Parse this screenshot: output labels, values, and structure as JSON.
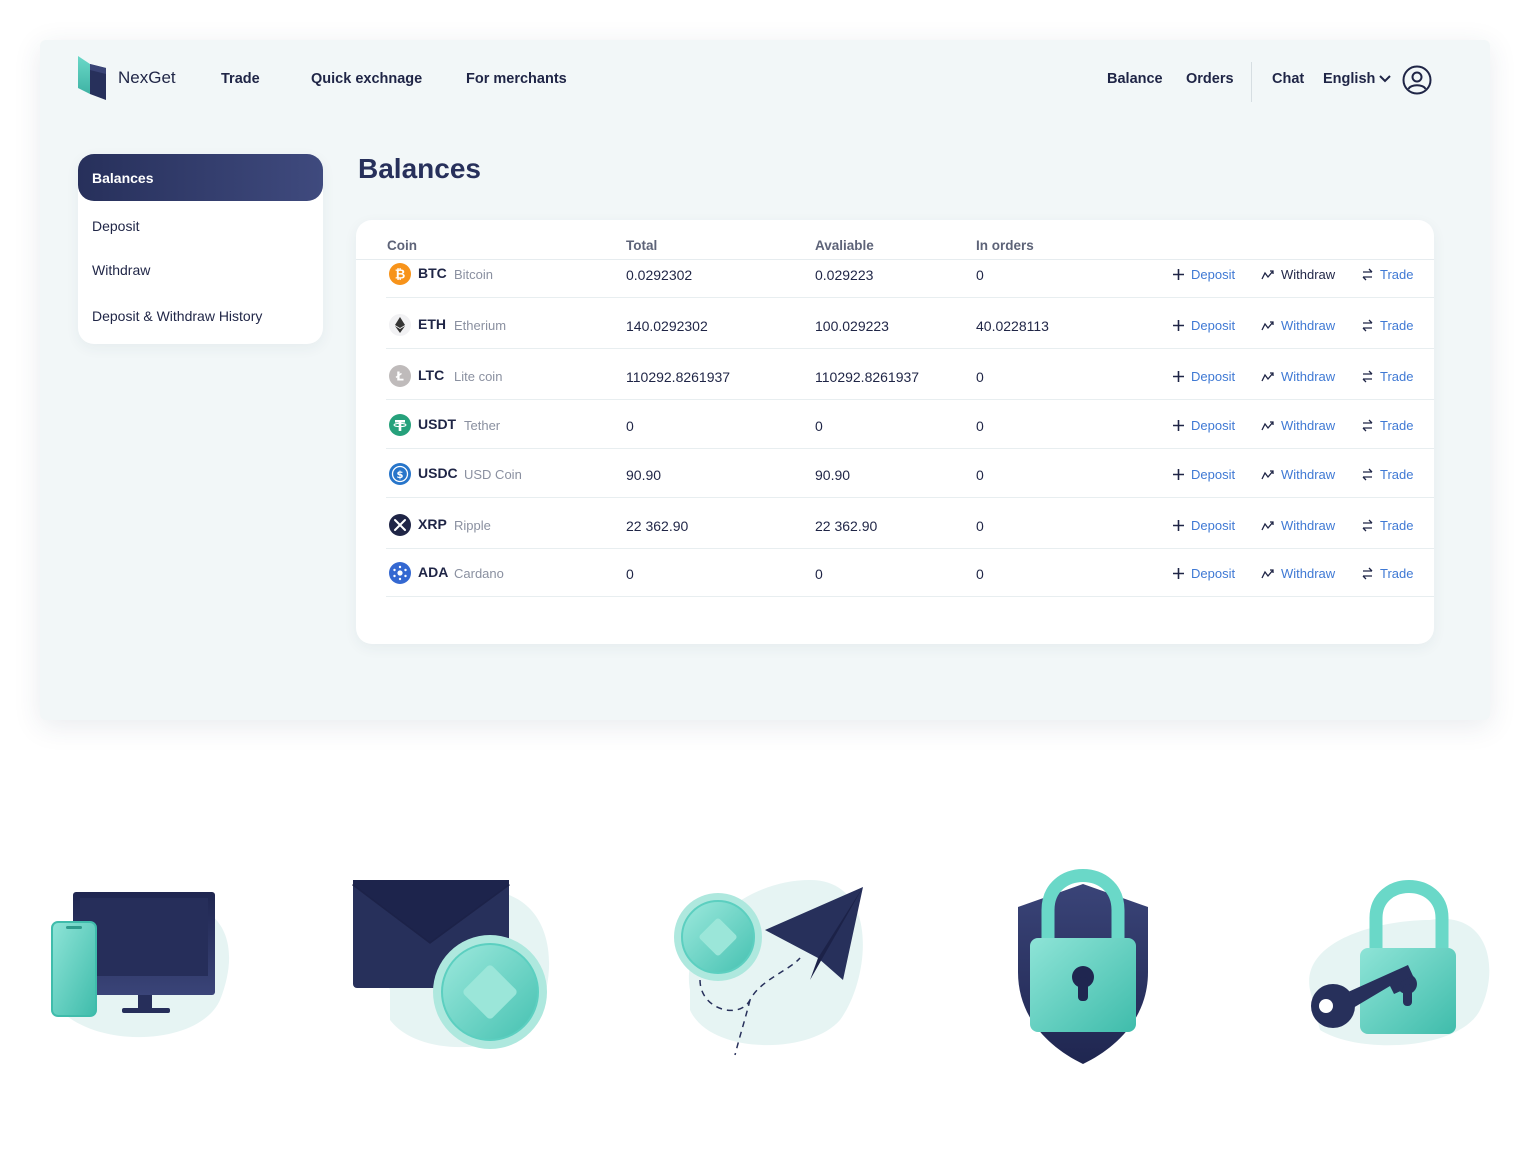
{
  "brand": {
    "name": "NexGet"
  },
  "nav": {
    "trade": "Trade",
    "quick_exchange": "Quick exchnage",
    "merchants": "For merchants",
    "balance": "Balance",
    "orders": "Orders",
    "chat": "Chat",
    "language": "English"
  },
  "sidebar": {
    "items": [
      {
        "label": "Balances",
        "active": true
      },
      {
        "label": "Deposit"
      },
      {
        "label": "Withdraw"
      },
      {
        "label": "Deposit & Withdraw History"
      }
    ]
  },
  "page_title": "Balances",
  "table": {
    "headers": {
      "coin": "Coin",
      "total": "Total",
      "available": "Avaliable",
      "in_orders": "In orders"
    },
    "actions": {
      "deposit": "Deposit",
      "withdraw": "Withdraw",
      "trade": "Trade"
    },
    "rows": [
      {
        "symbol": "BTC",
        "name": "Bitcoin",
        "total": "0.0292302",
        "available": "0.029223",
        "in_orders": "0",
        "icon": "bitcoin-icon",
        "color": "#f7931a"
      },
      {
        "symbol": "ETH",
        "name": "Etherium",
        "total": "140.0292302",
        "available": "100.029223",
        "in_orders": "40.0228113",
        "icon": "ethereum-icon",
        "color": "#343434"
      },
      {
        "symbol": "LTC",
        "name": "Lite coin",
        "total": "110292.8261937",
        "available": "110292.8261937",
        "in_orders": "0",
        "icon": "litecoin-icon",
        "color": "#bfbbbb"
      },
      {
        "symbol": "USDT",
        "name": "Tether",
        "total": "0",
        "available": "0",
        "in_orders": "0",
        "icon": "tether-icon",
        "color": "#26a17b"
      },
      {
        "symbol": "USDC",
        "name": "USD Coin",
        "total": "90.90",
        "available": "90.90",
        "in_orders": "0",
        "icon": "usdc-icon",
        "color": "#2775ca"
      },
      {
        "symbol": "XRP",
        "name": "Ripple",
        "total": "22 362.90",
        "available": "22 362.90",
        "in_orders": "0",
        "icon": "ripple-icon",
        "color": "#1f2546"
      },
      {
        "symbol": "ADA",
        "name": "Cardano",
        "total": "0",
        "available": "0",
        "in_orders": "0",
        "icon": "cardano-icon",
        "color": "#3468d1"
      }
    ]
  },
  "colors": {
    "accent_navy": "#27305b",
    "accent_teal": "#5ccfc0",
    "link_blue": "#3f79d4"
  },
  "illustrations": [
    "devices-illustration",
    "mail-coin-illustration",
    "paper-plane-coin-illustration",
    "shield-lock-illustration",
    "key-lock-illustration"
  ]
}
